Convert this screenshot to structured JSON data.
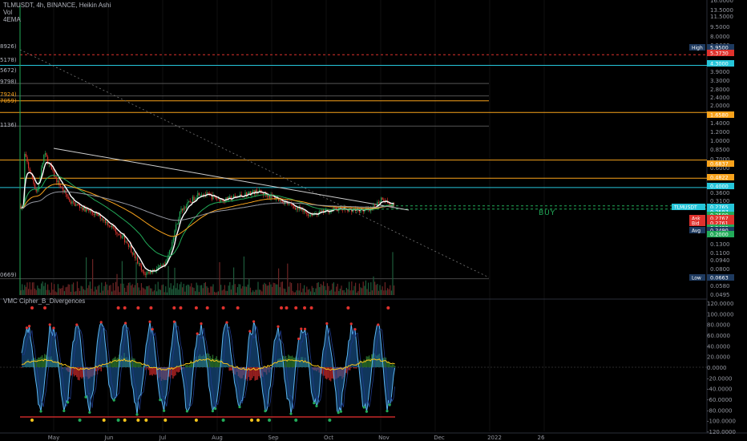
{
  "header": {
    "title": "TLMUSDT, 4h, BINANCE, Heikin Ashi",
    "line2": "Vol",
    "line3": "4EMA"
  },
  "indicator": {
    "name": "VMC Cipher_B_Divergences"
  },
  "price_axis": {
    "ticks": [
      "16.0000",
      "13.5000",
      "11.5000",
      "9.5000",
      "8.0000",
      "6.5000",
      "5.5000",
      "4.5000",
      "3.9000",
      "3.3000",
      "2.8000",
      "2.4000",
      "2.0000",
      "1.6000",
      "1.4000",
      "1.2000",
      "1.0000",
      "0.8500",
      "0.7000",
      "0.6000",
      "0.5000",
      "0.4200",
      "0.3600",
      "0.3100",
      "0.1500",
      "0.1300",
      "0.1100",
      "0.0940",
      "0.0800",
      "0.0680",
      "0.0580",
      "0.0495"
    ],
    "labels": [
      {
        "text": "High",
        "value": "5.9500",
        "color": "#1e3a5f"
      },
      {
        "text": "",
        "value": "5.3730",
        "color": "#e0322d"
      },
      {
        "text": "",
        "value": "4.3000",
        "color": "#26c6da"
      },
      {
        "text": "",
        "value": "1.6580",
        "color": "#f7a21b"
      },
      {
        "text": "",
        "value": "0.6837",
        "color": "#f7a21b"
      },
      {
        "text": "",
        "value": "0.4822",
        "color": "#f7a21b"
      },
      {
        "text": "",
        "value": "0.4000",
        "color": "#26c6da"
      },
      {
        "text": "TLMUSDT",
        "value": "0.2765",
        "color": "#26c6da"
      },
      {
        "text": "",
        "value": "0.2587",
        "color": "#26c6da"
      },
      {
        "text": "",
        "value": "0.2500",
        "color": "#22ab59"
      },
      {
        "text": "Ask",
        "value": "0.2767",
        "color": "#e0322d"
      },
      {
        "text": "Bid",
        "value": "0.2761",
        "color": "#e0322d"
      },
      {
        "text": "",
        "value": "0.2499",
        "color": "#22ab59"
      },
      {
        "text": "Avg",
        "value": "0.2490",
        "color": "#1e3a5f"
      },
      {
        "text": "",
        "value": "0.2000",
        "color": "#22ab59"
      },
      {
        "text": "Low",
        "value": "0.0663",
        "color": "#1e3a5f"
      }
    ]
  },
  "left_fib_labels": [
    {
      "text": "8926)",
      "color": "#b2b5be"
    },
    {
      "text": "5178)",
      "color": "#b2b5be"
    },
    {
      "text": "5672)",
      "color": "#b2b5be"
    },
    {
      "text": "9798)",
      "color": "#b2b5be"
    },
    {
      "text": "7924)",
      "color": "#f7a21b"
    },
    {
      "text": "7059)",
      "color": "#f7a21b"
    },
    {
      "text": "1136)",
      "color": "#b2b5be"
    },
    {
      "text": "0669)",
      "color": "#b2b5be"
    }
  ],
  "osc_axis": {
    "ticks": [
      "120.0000",
      "100.0000",
      "80.0000",
      "60.0000",
      "40.0000",
      "20.0000",
      "0.0000",
      "-20.0000",
      "-40.0000",
      "-60.0000",
      "-80.0000",
      "-100.0000",
      "-120.0000"
    ]
  },
  "time_axis": {
    "ticks": [
      "May",
      "Jun",
      "Jul",
      "Aug",
      "Sep",
      "Oct",
      "Nov",
      "Dec",
      "2022",
      "26"
    ]
  },
  "annotation": {
    "buy_label": "BUY"
  },
  "chart_data": [
    {
      "type": "candlestick",
      "symbol": "TLMUSDT",
      "timeframe": "4h",
      "exchange": "BINANCE",
      "style": "Heikin Ashi",
      "scale": "log",
      "x_range": [
        "2021-04-23",
        "2021-11-10"
      ],
      "y_range": [
        0.0495,
        16.0
      ],
      "high": 5.95,
      "low": 0.0663,
      "last": 0.2765,
      "approx_close_path": [
        {
          "date": "2021-04-25",
          "price": 0.8
        },
        {
          "date": "2021-05-02",
          "price": 0.36
        },
        {
          "date": "2021-05-06",
          "price": 0.78
        },
        {
          "date": "2021-05-12",
          "price": 0.48
        },
        {
          "date": "2021-05-20",
          "price": 0.3
        },
        {
          "date": "2021-06-05",
          "price": 0.22
        },
        {
          "date": "2021-06-20",
          "price": 0.13
        },
        {
          "date": "2021-06-28",
          "price": 0.072
        },
        {
          "date": "2021-07-10",
          "price": 0.085
        },
        {
          "date": "2021-07-18",
          "price": 0.25
        },
        {
          "date": "2021-07-28",
          "price": 0.36
        },
        {
          "date": "2021-08-10",
          "price": 0.31
        },
        {
          "date": "2021-08-28",
          "price": 0.37
        },
        {
          "date": "2021-09-10",
          "price": 0.31
        },
        {
          "date": "2021-09-25",
          "price": 0.23
        },
        {
          "date": "2021-10-10",
          "price": 0.26
        },
        {
          "date": "2021-10-28",
          "price": 0.25
        },
        {
          "date": "2021-11-03",
          "price": 0.33
        },
        {
          "date": "2021-11-08",
          "price": 0.2765
        }
      ],
      "horizontal_levels": [
        5.373,
        4.3,
        3.1,
        2.45,
        2.2,
        1.658,
        0.6837,
        0.4822,
        0.4,
        0.2765,
        0.2587,
        0.0663
      ]
    },
    {
      "type": "area",
      "name": "VMC Cipher_B_Divergences",
      "y_range": [
        -120,
        120
      ],
      "zero_line": 0
    }
  ]
}
